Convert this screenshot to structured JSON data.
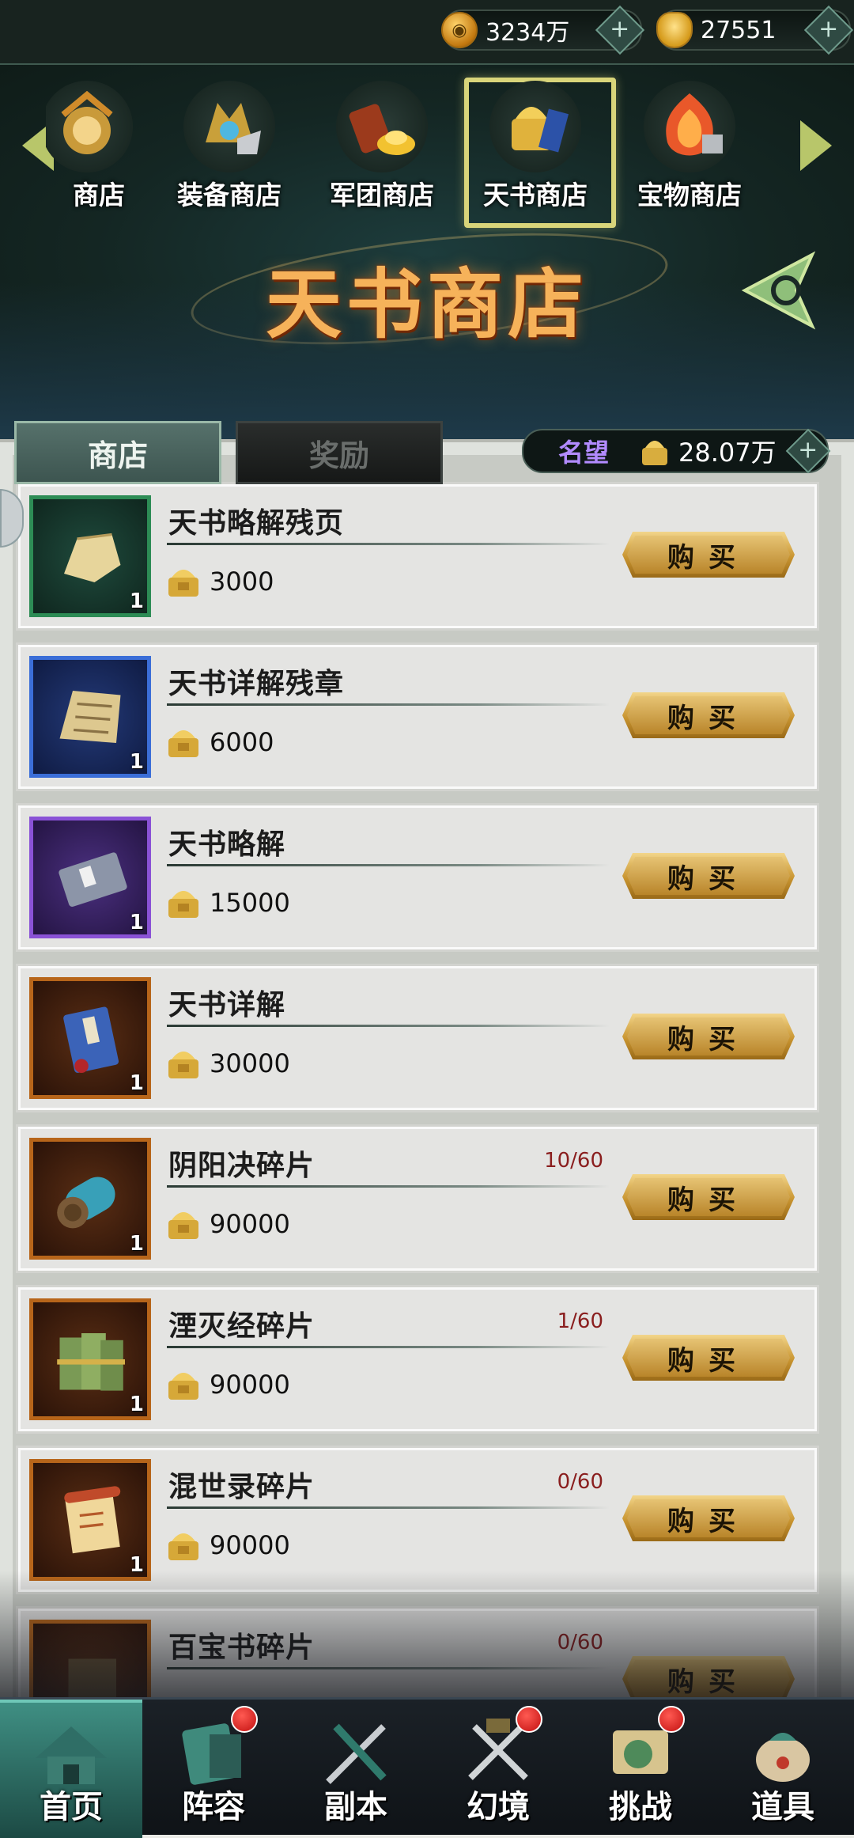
{
  "currencies": {
    "copper": "3234万",
    "ingot": "27551",
    "add_icon": "plus-icon"
  },
  "shop_tabs": [
    {
      "label": "商店",
      "icon": "shop-emblem-icon"
    },
    {
      "label": "装备商店",
      "icon": "equipment-shop-icon"
    },
    {
      "label": "军团商店",
      "icon": "legion-shop-icon"
    },
    {
      "label": "天书商店",
      "icon": "heavenly-book-shop-icon",
      "selected": true
    },
    {
      "label": "宝物商店",
      "icon": "treasure-shop-icon"
    }
  ],
  "title": "天书商店",
  "subtabs": {
    "shop": "商店",
    "reward": "奖励"
  },
  "prestige": {
    "label": "名望",
    "value": "28.07万"
  },
  "items": [
    {
      "name": "天书略解残页",
      "price": "3000",
      "count": "1",
      "quality": "green",
      "limit": "",
      "buy": "购买"
    },
    {
      "name": "天书详解残章",
      "price": "6000",
      "count": "1",
      "quality": "blue",
      "limit": "",
      "buy": "购买"
    },
    {
      "name": "天书略解",
      "price": "15000",
      "count": "1",
      "quality": "purple",
      "limit": "",
      "buy": "购买"
    },
    {
      "name": "天书详解",
      "price": "30000",
      "count": "1",
      "quality": "orange",
      "limit": "",
      "buy": "购买"
    },
    {
      "name": "阴阳决碎片",
      "price": "90000",
      "count": "1",
      "quality": "orange",
      "limit": "10/60",
      "buy": "购买"
    },
    {
      "name": "湮灭经碎片",
      "price": "90000",
      "count": "1",
      "quality": "orange",
      "limit": "1/60",
      "buy": "购买"
    },
    {
      "name": "混世录碎片",
      "price": "90000",
      "count": "1",
      "quality": "orange",
      "limit": "0/60",
      "buy": "购买"
    },
    {
      "name": "百宝书碎片",
      "price": "",
      "count": "",
      "quality": "orange",
      "limit": "0/60",
      "buy": "购买"
    }
  ],
  "bottom_nav": [
    {
      "label": "首页",
      "icon": "home-icon",
      "active": true,
      "badge": false
    },
    {
      "label": "阵容",
      "icon": "lineup-icon",
      "active": false,
      "badge": true
    },
    {
      "label": "副本",
      "icon": "dungeon-icon",
      "active": false,
      "badge": false
    },
    {
      "label": "幻境",
      "icon": "illusion-icon",
      "active": false,
      "badge": true
    },
    {
      "label": "挑战",
      "icon": "challenge-icon",
      "active": false,
      "badge": true
    },
    {
      "label": "道具",
      "icon": "items-icon",
      "active": false,
      "badge": false
    }
  ],
  "colors": {
    "accent_gold": "#d9b060",
    "prestige_purple": "#b28bff",
    "limit_red": "#8a1e1e",
    "badge_red": "#d61a1a"
  }
}
